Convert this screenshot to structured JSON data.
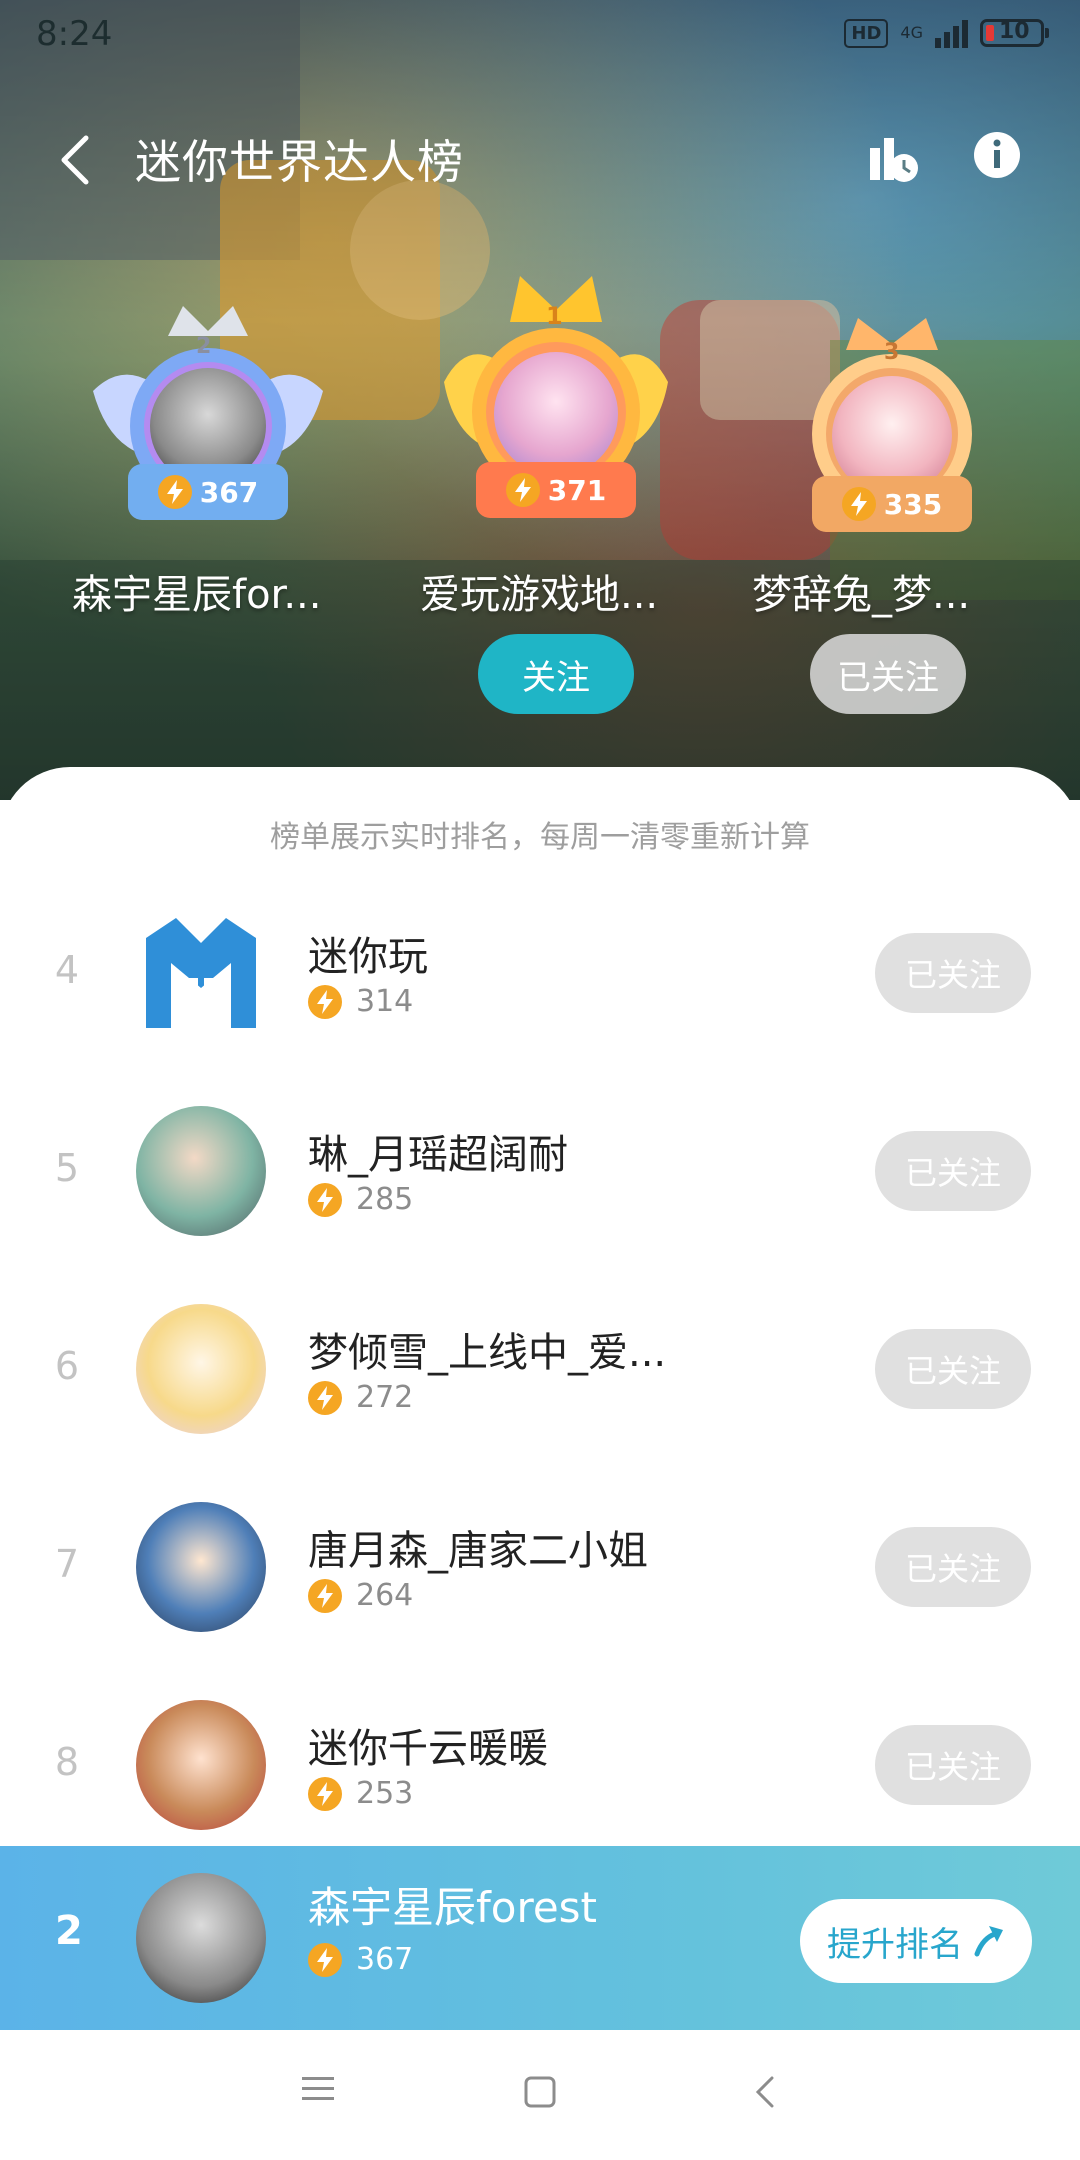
{
  "status_bar": {
    "time": "8:24",
    "hd": "HD",
    "network": "4G",
    "battery": "10"
  },
  "header": {
    "title": "迷你世界达人榜"
  },
  "podium": [
    {
      "rank": "1",
      "name": "爱玩游戏地...",
      "score": "371",
      "button": "关注"
    },
    {
      "rank": "2",
      "name": "森宇星辰for...",
      "score": "367"
    },
    {
      "rank": "3",
      "name": "梦辞兔_梦...",
      "score": "335",
      "button": "已关注"
    }
  ],
  "notice": "榜单展示实时排名，每周一清零重新计算",
  "list": [
    {
      "rank": "4",
      "name": "迷你玩",
      "score": "314",
      "button": "已关注"
    },
    {
      "rank": "5",
      "name": "琳_月瑶超阔耐",
      "score": "285",
      "button": "已关注"
    },
    {
      "rank": "6",
      "name": "梦倾雪_上线中_爱...",
      "score": "272",
      "button": "已关注"
    },
    {
      "rank": "7",
      "name": "唐月森_唐家二小姐",
      "score": "264",
      "button": "已关注"
    },
    {
      "rank": "8",
      "name": "迷你千云暖暖",
      "score": "253",
      "button": "已关注"
    }
  ],
  "me": {
    "rank": "2",
    "name": "森宇星辰forest",
    "score": "367",
    "button": "提升排名"
  },
  "colors": {
    "accent": "#1fb5c6",
    "bolt": "#f5a623",
    "followed": "#e0e0e0",
    "me_bar": "#5bb3e8"
  }
}
